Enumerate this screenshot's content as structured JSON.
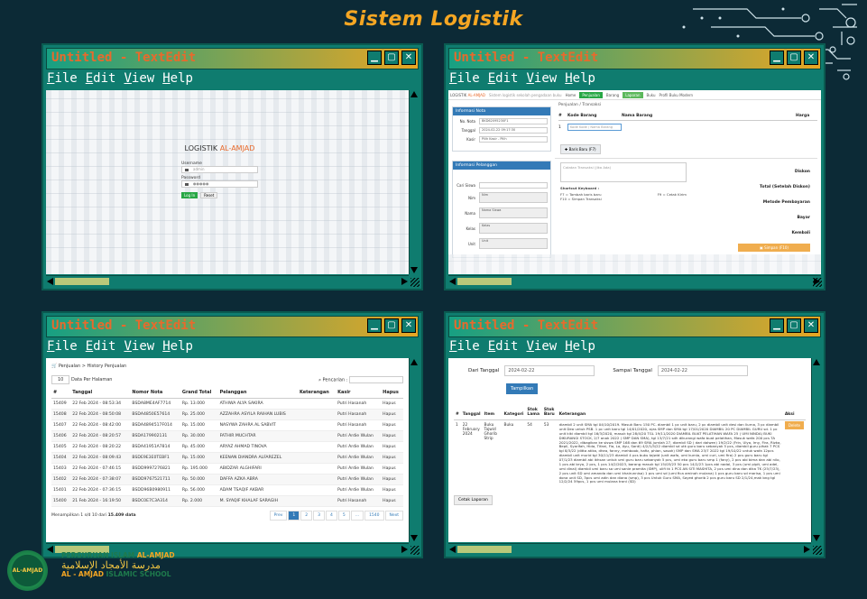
{
  "page_title": "Sistem Logistik",
  "colors": {
    "title": "#f5a623",
    "window_frame": "#0f7c6f",
    "window_title_text": "#e86a2c",
    "background": "#0c2a36"
  },
  "window_title": "Untitled - TextEdit",
  "menu": [
    "File",
    "Edit",
    "View",
    "Help"
  ],
  "win1": {
    "logo_main": "LOGISTIK",
    "logo_accent": "AL-AMJAD",
    "username_label": "Username",
    "username_value": "admin",
    "password_label": "Password",
    "password_value": "●●●●●",
    "login_button": "Log In",
    "reset_button": "Reset"
  },
  "win2": {
    "brand": "LOGISTIK",
    "brand_accent": "AL-AMJAD",
    "nav": [
      "Home",
      "Penjualan",
      "Barang",
      "Laporan",
      "Buku",
      "Profil Buku Modern"
    ],
    "nav_tagline": "Sistem logistik sekolah pengadaan buku",
    "breadcrumb": "Penjualan / Transaksi",
    "info_nota_title": "Informasi Nota",
    "no_nota_label": "No. Nota",
    "no_nota_value": "BKD62095230F1",
    "tanggal_label": "Tanggal",
    "tanggal_value": "2024-02-22 09:17:30",
    "kasir_label": "Kasir",
    "kasir_value": "Pilih Kasir - Pilih",
    "info_pelanggan_title": "Informasi Pelanggan",
    "cari_siswa_label": "Cari Siswa",
    "nim_label": "Nim",
    "nim_value": "Nim",
    "nama_label": "Nama",
    "nama_value": "Nama Siswa",
    "kelas_label": "Kelas",
    "kelas_value": "Kelas",
    "unit_label": "Unit",
    "unit_value": "Unit",
    "col_no": "#",
    "col_kode": "Kode Barang",
    "col_nama": "Nama Barang",
    "col_harga": "Harga",
    "row1_no": "1",
    "row1_placeholder": "Kode Kode / Nama Barang",
    "add_button": "Baris Baru (F7)",
    "catatan_placeholder": "Catatan Transaksi (Jika Ada)",
    "diskon_label": "Diskon",
    "total_label": "Total (Setelah Diskon)",
    "shortcut_title": "Shortcut Keyboard :",
    "shortcut_f7": "F7 = Tambah baris baru",
    "shortcut_f9": "F9 = Cetak Kirim",
    "shortcut_f10": "F10 = Simpan Transaksi",
    "metode_label": "Metode Pembayaran",
    "bayar_label": "Bayar",
    "kembali_label": "Kembali",
    "simpan_button": "Simpan (F10)"
  },
  "win3": {
    "breadcrumb": "Penjualan > History Penjualan",
    "per_page": "10",
    "per_page_label": "Data Per Halaman",
    "search_label": "Pencarian :",
    "headers": [
      "#",
      "Tanggal",
      "Nomor Nota",
      "Grand Total",
      "Pelanggan",
      "Keterangan",
      "Kasir",
      "Hapus"
    ],
    "rows": [
      [
        "15409",
        "22 Feb 2024 - 08:53:34",
        "BSDA8ME4AF7714",
        "Rp. 13.000",
        "ATHIWA ALYA SAKIRA",
        "",
        "Putri Hasanah",
        "Hapus"
      ],
      [
        "15408",
        "22 Feb 2024 - 08:50:08",
        "BSDA4850E57614",
        "Rp. 25.000",
        "AZZAHRA ASYILA RAIHAN LUBIS",
        "",
        "Putri Hasanah",
        "Hapus"
      ],
      [
        "15407",
        "22 Feb 2024 - 08:42:00",
        "BSDA4894517F014",
        "Rp. 15.000",
        "NASYWA ZAHRA AL SABVIT",
        "",
        "Putri Hasanah",
        "Hapus"
      ],
      [
        "15406",
        "22 Feb 2024 - 08:20:57",
        "BSDA179902131",
        "Rp. 30.000",
        "FATHIR MUCHTAR",
        "",
        "Putri Ardie Wulan",
        "Hapus"
      ],
      [
        "15405",
        "22 Feb 2024 - 08:20:22",
        "BSDA41951A7814",
        "Rp. 45.000",
        "ARYAZ AHMAD TINOVA",
        "",
        "Putri Ardie Wulan",
        "Hapus"
      ],
      [
        "15404",
        "22 Feb 2024 - 08:09:43",
        "BSDE9E3E0TEBF1",
        "Rp. 15.000",
        "KEENAN DIANDRA ALFAREZEL",
        "",
        "Putri Ardie Wulan",
        "Hapus"
      ],
      [
        "15403",
        "22 Feb 2024 - 07:46:15",
        "BSDD9997276821",
        "Rp. 195.000",
        "ABIDZAR ALGHIFARI",
        "",
        "Putri Ardie Wulan",
        "Hapus"
      ],
      [
        "15402",
        "22 Feb 2024 - 07:38:07",
        "BSDD9767521711",
        "Rp. 50.000",
        "DAFFA AZKA ABRA",
        "",
        "Putri Ardie Wulan",
        "Hapus"
      ],
      [
        "15401",
        "22 Feb 2024 - 07:36:15",
        "BSDD96B0980911",
        "Rp. 56.000",
        "ADAM TSAQIF AKBAR",
        "",
        "Putri Ardie Wulan",
        "Hapus"
      ],
      [
        "15400",
        "21 Feb 2024 - 16:19:50",
        "BSDC0E7C3A314",
        "Rp. 2.000",
        "M. SYAQIF KHALAF SARAGIH",
        "",
        "Putri Hasanah",
        "Hapus"
      ]
    ],
    "footer_info": "Menampilkan 1 s/d 10 dari",
    "footer_total": "15.409 data",
    "pages": [
      "Prev",
      "1",
      "2",
      "3",
      "4",
      "5",
      "...",
      "1540",
      "Next"
    ]
  },
  "win4": {
    "dari_label": "Dari Tanggal",
    "dari_value": "2024-02-22",
    "sampai_label": "Sampai Tanggal",
    "sampai_value": "2024-02-22",
    "show_button": "Tampilkan",
    "headers": [
      "#",
      "Tanggal",
      "Item",
      "Kategori",
      "Stok Lama",
      "Stok Baru",
      "Keterangan",
      "Aksi"
    ],
    "row_no": "1",
    "row_tanggal": "22 February 2024",
    "row_item": "Buku Tajwid Ghorib Strip",
    "row_kategori": "Buku",
    "row_stok_lama": "54",
    "row_stok_baru": "53",
    "row_keterangan": "diambil 2 unit SMA tgl 04/10/2019. Masuk Baru 150 PC. diambil 1 pc unit baru, 2 pc diambil unit desi dan liurna, 3 pc diambil unit Dea untuk PSB. 1 pc unit baru tgl 14/01/2020, a/as SMP dan SMA tgl 17/01/2020 DIAMBIL 20 PC DIAMBIL GURU sd. 1 pc unit kiki diambil tgl 16/3/2020, masuk tgl 28/4/20 TGL 19/11/2020 DIAMBIL BUAT PELATIHAN WAFA 25 ( UMI NINDA) BUKI DIKURANGI STOCK, 2/7 anak 2022 ( SMP DAN SMA), tgl 13/7/21 sdh dikurangi wafa buat pelatihan, Masuk wafa 200 pcs TA 2021/2022, dibagikan ke siswa SMP 168 dan 69 SMA jumlah 27, diambil SD ( dari dalwen) 19/2/22 (Frin, Ulya, Irny, Fira, Rizka, Bepli, Syarifah, Hida, Tifani, Fia, La, Ayu, Santi) 4/2/1/5/22 diambil sd utk guru baru sebanyak 5 pcs, diambil guru pihak 7 PCS tgl 8/3/22 (ditta atika, dhea, fanny, mehboob, hafiz, phian, sasah) SMP dan SMA 23/7 2022 tgl 19/10/22 untuk wafa 12pcs diambil unit murid tgl 30/11/23 diambil 4 pcs buku tajwid (unit wafa, umi kurnia, umi curi, umi fira) 2 pcs guru baru tgl 07/1/23 diambil abi ikhsan untuk umi guru baru sebanyak 5 pcs, umi eka guru baru smp 1 (fany), 2 pcs abi bima dan abi nilo, 1 pcs abi bryo, 2 pcs, 1 pcs 14/2/2023, barang masuk tgl 15/03/23 50 pcs 14/2/23 1pcs abi nadal, 3 pcs (umi pipit, umi adel, umi dinal) diambil umi baru sa umi sanie pramita (SMP), ulifi tk 1 PCS AN SITI MASHITA, 2 pcs umi dina dan dika TK (25/7/23), 2 pcs unit SD umi amanda dan umi khairunnisa) 1 pcs umi sd (umi fica aminah mulana) 1 pcs guru baru sd marisa, 1 pcs umi dona unit SD, 3pcs umi adin dan diana (smp), 3 pcs Untuk Guru SMA, Sayed ghorib 2 pcs guru baru SD 2/1/24,mak bng tgl 12/2/24 59pcs, 1 pcs umi mulana trani (SD)",
    "delete_button": "Delete",
    "print_button": "Cetak Laporan"
  },
  "school": {
    "line1_a": "PERGURUAN ISLAM",
    "line1_b": "AL-AMJAD",
    "line2": "مدرسة الأمجاد الإسلامية",
    "line3_a": "AL - AMJAD",
    "line3_b": "ISLAMIC SCHOOL",
    "seal_text": "AL-AMJAD"
  }
}
